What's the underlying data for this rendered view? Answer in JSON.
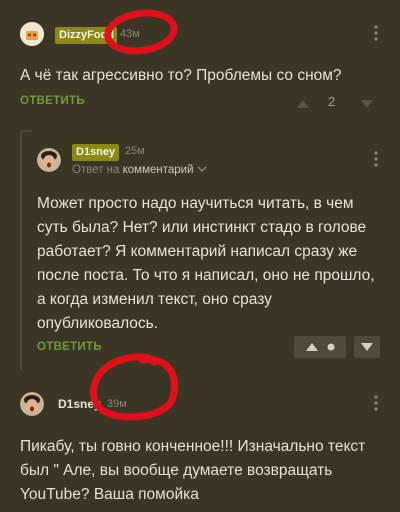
{
  "comment1": {
    "author": "DizzyFood",
    "time": "43м",
    "text": "А чё так агрессивно то? Проблемы со сном?",
    "reply_label": "ОТВЕТИТЬ",
    "rating": "2"
  },
  "comment2": {
    "author": "D1sney",
    "time": "25м",
    "reply_context_prefix": "Ответ на",
    "reply_context_link": "комментарий",
    "text": "Может просто надо научиться читать, в чем суть была? Нет? или инстинкт стадо в голове работает? Я комментарий написал сразу же после поста. То что я написал, оно не прошло, а когда изменил текст, оно сразу опубликовалось.",
    "reply_label": "ОТВЕТИТЬ"
  },
  "comment3": {
    "author": "D1sney",
    "time": "39м",
    "text": "Пикабу, ты говно конченное!!! Изначально текст был \" Але, вы вообще думаете возвращать YouTube? Ваша помойка"
  },
  "colors": {
    "background": "#3b3526",
    "accent_green": "#6f9a3c",
    "badge_olive": "#8a8a10",
    "annotation_red": "#e0101a"
  },
  "icons": [
    "more-vertical-icon",
    "arrow-up-icon",
    "arrow-down-icon",
    "chevron-down-icon"
  ]
}
